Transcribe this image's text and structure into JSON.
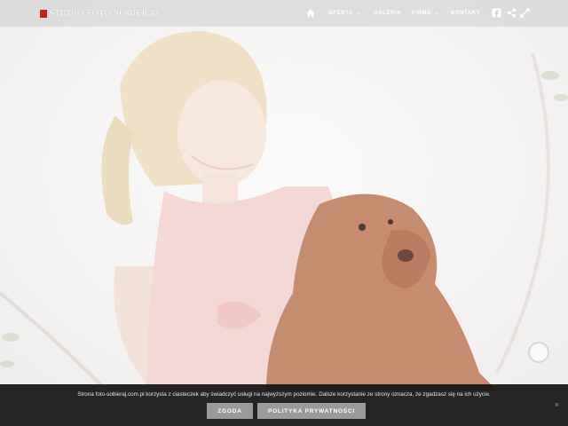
{
  "brand": {
    "name": "STUDIO FOTO SOBIERAJ",
    "accent_color": "#c9211e"
  },
  "nav": {
    "home_icon": "home-icon",
    "items": [
      {
        "label": "OFERTA",
        "has_dropdown": true
      },
      {
        "label": "GALERIA",
        "has_dropdown": false
      },
      {
        "label": "FIRMA",
        "has_dropdown": true
      },
      {
        "label": "KONTAKT",
        "has_dropdown": false
      }
    ],
    "icons": [
      "facebook-icon",
      "share-icon",
      "fullscreen-icon"
    ]
  },
  "cookie_bar": {
    "text": "Strona foto-sobieraj.com.pl korzysta z ciasteczek aby świadczyć usługi na najwyższym poziomie. Dalsze korzystanie ze strony oznacza, że zgadzasz się na ich użycie.",
    "agree_label": "ZGODA",
    "policy_label": "POLITYKA PRYWATNOŚCI",
    "close_label": "×"
  }
}
